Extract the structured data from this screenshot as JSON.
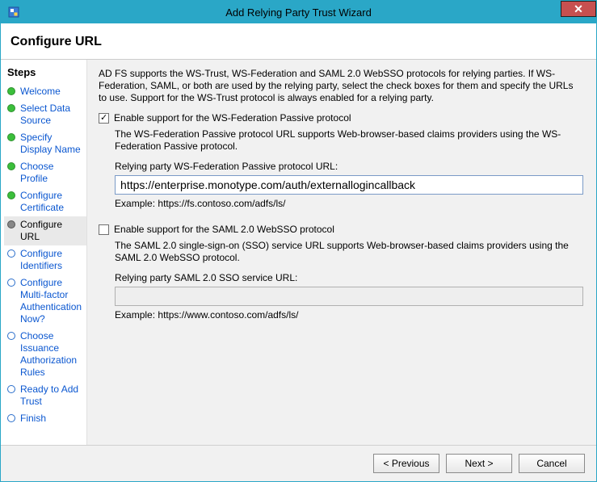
{
  "window": {
    "title": "Add Relying Party Trust Wizard",
    "close_glyph": "✕"
  },
  "heading": "Configure URL",
  "sidebar": {
    "title": "Steps",
    "items": [
      {
        "label": "Welcome"
      },
      {
        "label": "Select Data Source"
      },
      {
        "label": "Specify Display Name"
      },
      {
        "label": "Choose Profile"
      },
      {
        "label": "Configure Certificate"
      },
      {
        "label": "Configure URL"
      },
      {
        "label": "Configure Identifiers"
      },
      {
        "label": "Configure Multi-factor Authentication Now?"
      },
      {
        "label": "Choose Issuance Authorization Rules"
      },
      {
        "label": "Ready to Add Trust"
      },
      {
        "label": "Finish"
      }
    ]
  },
  "intro": "AD FS supports the WS-Trust, WS-Federation and SAML 2.0 WebSSO protocols for relying parties.  If WS-Federation, SAML, or both are used by the relying party, select the check boxes for them and specify the URLs to use.  Support for the WS-Trust protocol is always enabled for a relying party.",
  "wsfed": {
    "checkbox_label": "Enable support for the WS-Federation Passive protocol",
    "check_glyph": "✓",
    "desc": "The WS-Federation Passive protocol URL supports Web-browser-based claims providers using the WS-Federation Passive protocol.",
    "field_label": "Relying party WS-Federation Passive protocol URL:",
    "value": "https://enterprise.monotype.com/auth/externallogincallback",
    "example": "Example: https://fs.contoso.com/adfs/ls/"
  },
  "saml": {
    "checkbox_label": "Enable support for the SAML 2.0 WebSSO protocol",
    "desc": "The SAML 2.0 single-sign-on (SSO) service URL supports Web-browser-based claims providers using the SAML 2.0 WebSSO protocol.",
    "field_label": "Relying party SAML 2.0 SSO service URL:",
    "value": "",
    "example": "Example: https://www.contoso.com/adfs/ls/"
  },
  "buttons": {
    "previous": "< Previous",
    "next": "Next >",
    "cancel": "Cancel"
  }
}
